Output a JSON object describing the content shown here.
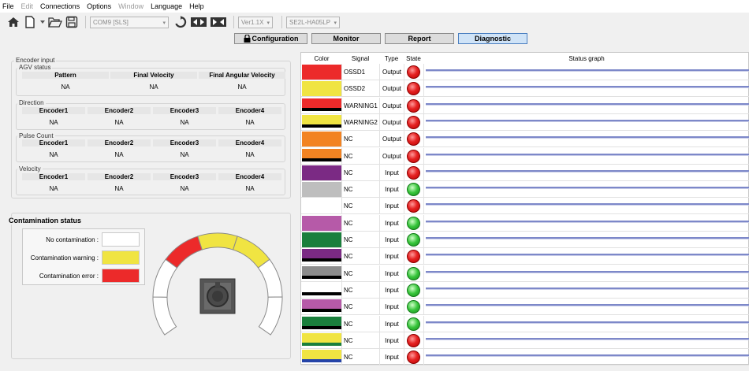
{
  "menu": [
    "File",
    "Edit",
    "Connections",
    "Options",
    "Window",
    "Language",
    "Help"
  ],
  "menu_disabled": [
    false,
    true,
    false,
    false,
    true,
    false,
    false
  ],
  "toolbar": {
    "port_combo": "COM9 [SLS]",
    "version_combo": "Ver1.1X",
    "model_combo": "SE2L-HA05LP",
    "icons": [
      "home-icon",
      "new-file-icon",
      "dropdown-icon",
      "open-folder-icon",
      "save-icon",
      "refresh-icon",
      "connect-icon",
      "disconnect-icon"
    ]
  },
  "tabs": [
    {
      "label": "Configuration",
      "active": false
    },
    {
      "label": "Monitor",
      "active": false
    },
    {
      "label": "Report",
      "active": false
    },
    {
      "label": "Diagnostic",
      "active": true
    }
  ],
  "encoder": {
    "title": "Encoder input",
    "agv": {
      "title": "AGV status",
      "headers": [
        "Pattern",
        "Final Velocity",
        "Final Angular Velocity"
      ],
      "values": [
        "NA",
        "NA",
        "NA"
      ]
    },
    "direction": {
      "title": "Direction",
      "headers": [
        "Encoder1",
        "Encoder2",
        "Encoder3",
        "Encoder4"
      ],
      "values": [
        "NA",
        "NA",
        "NA",
        "NA"
      ]
    },
    "pulse": {
      "title": "Pulse Count",
      "headers": [
        "Encoder1",
        "Encoder2",
        "Encoder3",
        "Encoder4"
      ],
      "values": [
        "NA",
        "NA",
        "NA",
        "NA"
      ]
    },
    "velocity": {
      "title": "Velocity",
      "headers": [
        "Encoder1",
        "Encoder2",
        "Encoder3",
        "Encoder4"
      ],
      "values": [
        "NA",
        "NA",
        "NA",
        "NA"
      ]
    }
  },
  "contamination": {
    "title": "Contamination status",
    "legend": [
      {
        "label": "No contamination :",
        "color": "#ffffff"
      },
      {
        "label": "Contamination warning :",
        "color": "#f0e442"
      },
      {
        "label": "Contamination error :",
        "color": "#ec2a2a"
      }
    ],
    "segments": [
      "none",
      "none",
      "error",
      "warning",
      "warning",
      "none",
      "none"
    ]
  },
  "table": {
    "headers": {
      "color": "Color",
      "signal": "Signal",
      "type": "Type",
      "state": "State",
      "graph": "Status graph"
    },
    "rows": [
      {
        "colors": [
          "#ec2a2a"
        ],
        "signal": "OSSD1",
        "type": "Output",
        "state": "red"
      },
      {
        "colors": [
          "#f0e442"
        ],
        "signal": "OSSD2",
        "type": "Output",
        "state": "red"
      },
      {
        "colors": [
          "#ec2a2a",
          "#000000"
        ],
        "signal": "WARNING1",
        "type": "Output",
        "state": "red"
      },
      {
        "colors": [
          "#f0e442",
          "#000000"
        ],
        "signal": "WARNING2",
        "type": "Output",
        "state": "red"
      },
      {
        "colors": [
          "#f28322"
        ],
        "signal": "NC",
        "type": "Output",
        "state": "red"
      },
      {
        "colors": [
          "#f28322",
          "#000000"
        ],
        "signal": "NC",
        "type": "Output",
        "state": "red"
      },
      {
        "colors": [
          "#7b2a84"
        ],
        "signal": "NC",
        "type": "Input",
        "state": "red"
      },
      {
        "colors": [
          "#bebebe"
        ],
        "signal": "NC",
        "type": "Input",
        "state": "green"
      },
      {
        "colors": [
          "#ffffff"
        ],
        "signal": "NC",
        "type": "Input",
        "state": "red"
      },
      {
        "colors": [
          "#b65aa8"
        ],
        "signal": "NC",
        "type": "Input",
        "state": "green"
      },
      {
        "colors": [
          "#1a7f3c"
        ],
        "signal": "NC",
        "type": "Input",
        "state": "green"
      },
      {
        "colors": [
          "#7b2a84",
          "#000000"
        ],
        "signal": "NC",
        "type": "Input",
        "state": "red"
      },
      {
        "colors": [
          "#8c8c8c",
          "#000000"
        ],
        "signal": "NC",
        "type": "Input",
        "state": "green"
      },
      {
        "colors": [
          "#ffffff",
          "#000000"
        ],
        "signal": "NC",
        "type": "Input",
        "state": "green"
      },
      {
        "colors": [
          "#b65aa8",
          "#000000"
        ],
        "signal": "NC",
        "type": "Input",
        "state": "green"
      },
      {
        "colors": [
          "#1a7f3c",
          "#000000"
        ],
        "signal": "NC",
        "type": "Input",
        "state": "green"
      },
      {
        "colors": [
          "#f0e442",
          "#1a7f3c"
        ],
        "signal": "NC",
        "type": "Input",
        "state": "red"
      },
      {
        "colors": [
          "#f0e442",
          "#2544a8"
        ],
        "signal": "NC",
        "type": "Input",
        "state": "red"
      }
    ]
  }
}
